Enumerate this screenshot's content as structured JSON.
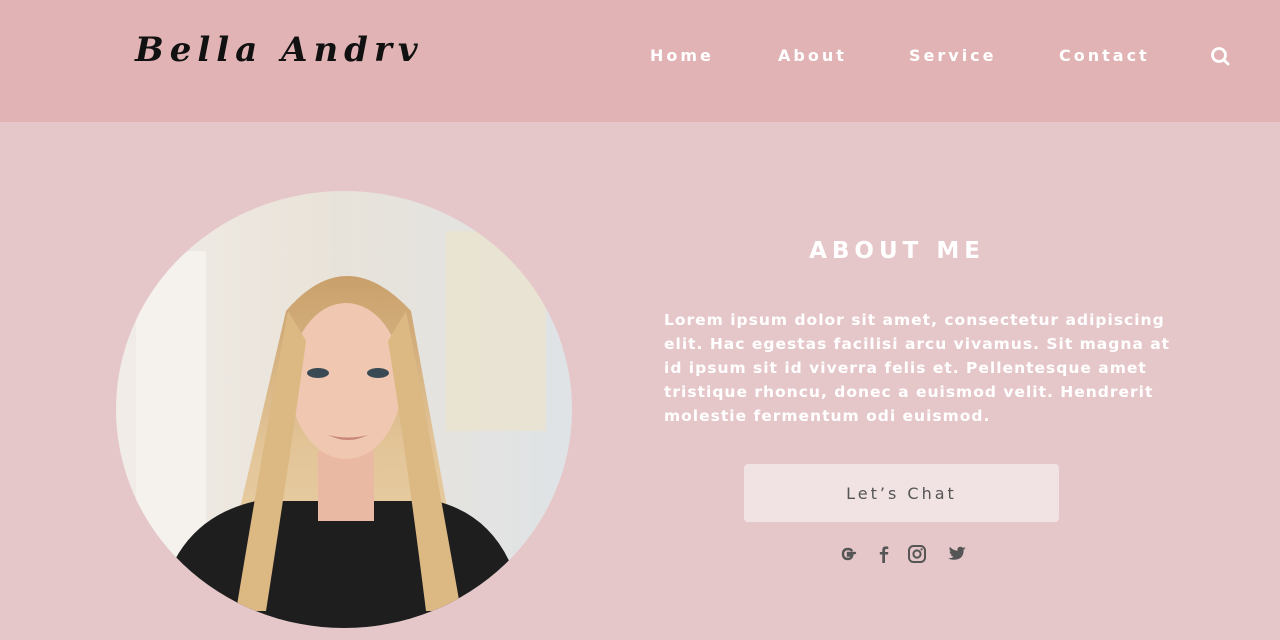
{
  "header": {
    "logo": "Bella Andrv",
    "nav": [
      {
        "label": "Home"
      },
      {
        "label": "About"
      },
      {
        "label": "Service"
      },
      {
        "label": "Contact"
      }
    ],
    "search_icon": "search-icon"
  },
  "profile": {
    "photo_icon": "portrait-photo"
  },
  "about": {
    "title": "ABOUT ME",
    "text": "Lorem ipsum dolor sit amet, consectetur adipiscing elit. Hac egestas facilisi arcu vivamus. Sit magna at id ipsum sit id viverra felis et. Pellentesque amet tristique rhoncu, donec a euismod velit. Hendrerit molestie fermentum odi euismod.",
    "button_label": "Let’s Chat"
  },
  "social": [
    {
      "icon": "google-icon"
    },
    {
      "icon": "facebook-icon"
    },
    {
      "icon": "instagram-icon"
    },
    {
      "icon": "twitter-icon"
    }
  ],
  "colors": {
    "page_bg": "#e6c7c9",
    "header_bg": "#e1b3b4",
    "button_bg": "#f1e2e3",
    "text_light": "#ffffff",
    "icon_dark": "#555555"
  }
}
